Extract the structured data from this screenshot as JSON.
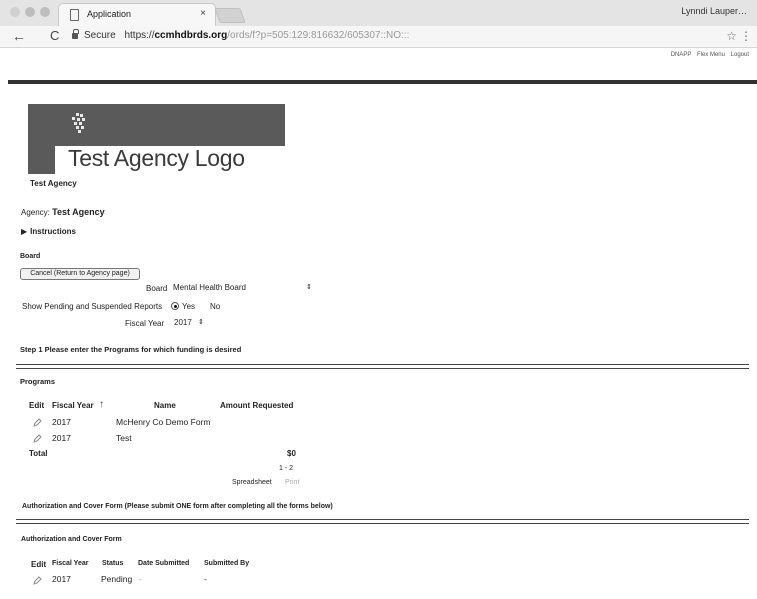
{
  "browser": {
    "tab_title": "Application",
    "tab_close": "×",
    "user": "Lynndi Lauper…",
    "secure_label": "Secure",
    "url_scheme": "https://",
    "url_host": "ccmhdbrds.org",
    "url_path": "/ords/f?p=505:129:816632/605307::NO:::",
    "back_icon": "arrow-left",
    "reload_icon": "reload",
    "star_icon": "star",
    "menu_icon": "kebab-menu"
  },
  "header": {
    "links": [
      "DNAPP",
      "Flex Menu",
      "Logout"
    ]
  },
  "logo": {
    "text": "Test Agency Logo",
    "mark_icon": "cube-stack"
  },
  "agency": {
    "name": "Test Agency",
    "label": "Agency:",
    "value": "Test Agency",
    "instructions_label": "Instructions",
    "instructions_icon": "triangle-right"
  },
  "board": {
    "heading": "Board",
    "cancel_button": "Cancel (Return to Agency page)",
    "board_label": "Board",
    "board_selected": "Mental Health Board",
    "pending_label": "Show Pending and Suspended Reports",
    "yes_label": "Yes",
    "no_label": "No",
    "fiscal_year_label": "Fiscal Year",
    "fiscal_year_selected": "2017",
    "select_arrow": "⇕"
  },
  "step1": "Step 1  Please enter the Programs for which funding is desired",
  "programs": {
    "heading": "Programs",
    "columns": [
      "Edit",
      "Fiscal Year",
      "Name",
      "Amount Requested"
    ],
    "rows": [
      {
        "fiscal_year": "2017",
        "name": "McHenry Co Demo Form"
      },
      {
        "fiscal_year": "2017",
        "name": "Test"
      }
    ],
    "total_label": "Total",
    "total_value": "$0",
    "pagination": "1 - 2",
    "spreadsheet_label": "Spreadsheet",
    "print_label": "Print"
  },
  "authorization": {
    "heading": "Authorization and Cover Form (Please submit ONE form after completing all the forms below)",
    "sub_heading": "Authorization and Cover Form",
    "columns": [
      "Edit",
      "Fiscal Year",
      "Status",
      "Date Submitted",
      "Submitted By"
    ],
    "rows": [
      {
        "fiscal_year": "2017",
        "status": "Pending",
        "date_submitted": "-",
        "submitted_by": "-"
      }
    ]
  }
}
